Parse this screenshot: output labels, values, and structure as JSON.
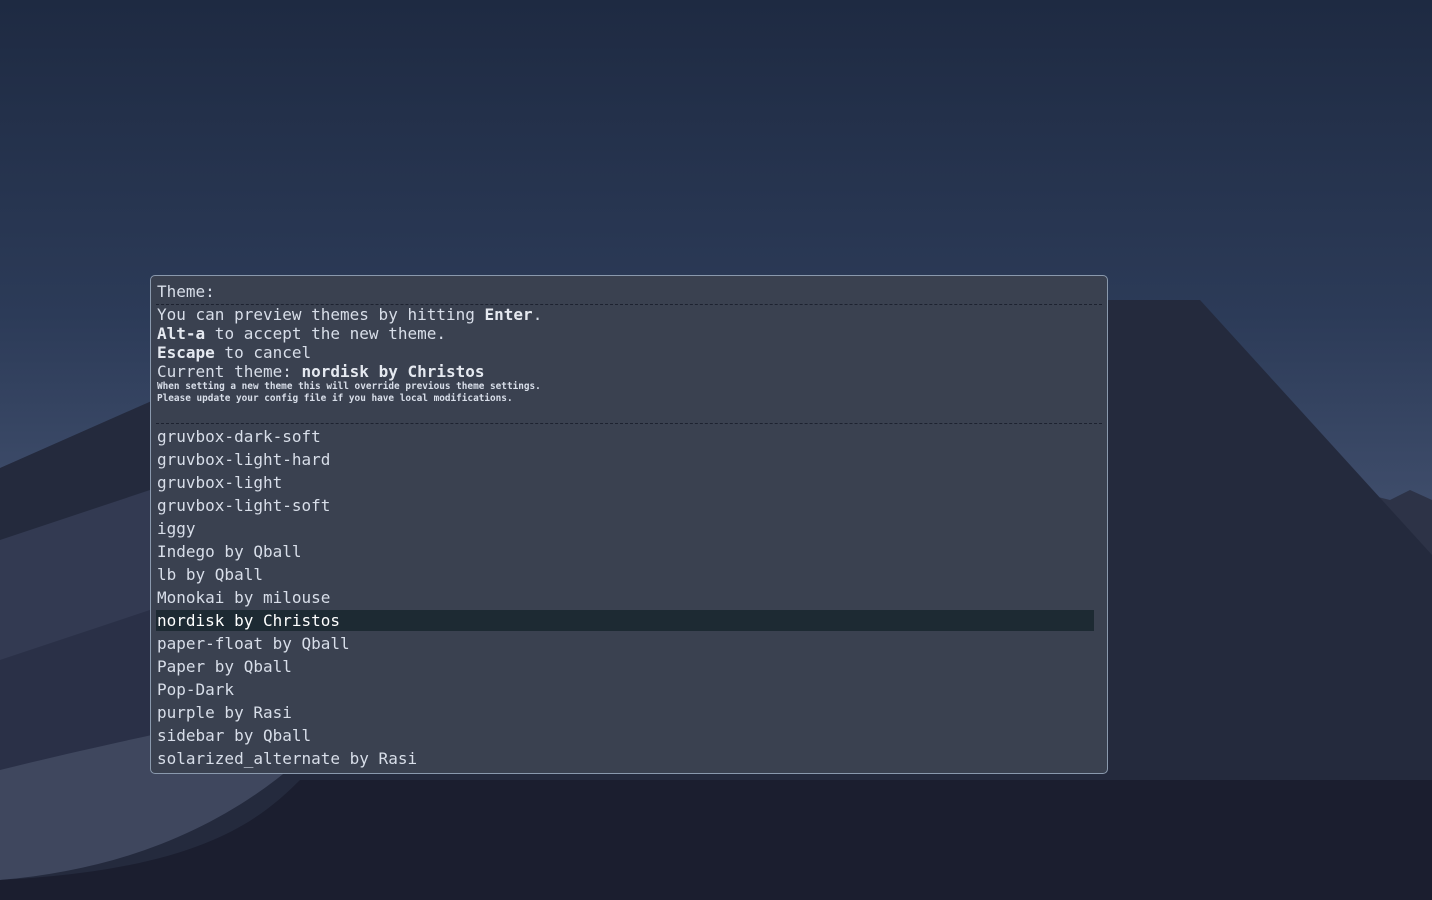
{
  "colors": {
    "window_bg": "#3a4150",
    "window_border": "#8a99ad",
    "text": "#d8dee9",
    "selected_bg": "#1d2a33",
    "selected_text": "#ffffff",
    "separator": "#1d2230"
  },
  "prompt": "Theme:",
  "message": {
    "line1": {
      "pre": "You can preview themes by hitting ",
      "bold": "Enter",
      "post": "."
    },
    "line2": {
      "bold": "Alt-a",
      "post": " to accept the new theme."
    },
    "line3": {
      "bold": "Escape",
      "post": " to cancel"
    },
    "line4": {
      "pre": "Current theme: ",
      "bold": "nordisk by Christos"
    },
    "note1": "When setting a new theme this will override previous theme settings.",
    "note2": "Please update your config file if you have local modifications."
  },
  "themes": [
    {
      "label": "gruvbox-dark-soft"
    },
    {
      "label": "gruvbox-light-hard"
    },
    {
      "label": "gruvbox-light"
    },
    {
      "label": "gruvbox-light-soft"
    },
    {
      "label": "iggy"
    },
    {
      "label": "Indego by Qball"
    },
    {
      "label": "lb by Qball"
    },
    {
      "label": "Monokai by milouse"
    },
    {
      "label": "nordisk by Christos",
      "selected": true
    },
    {
      "label": "paper-float by Qball"
    },
    {
      "label": "Paper by Qball"
    },
    {
      "label": "Pop-Dark"
    },
    {
      "label": "purple by Rasi"
    },
    {
      "label": "sidebar by Qball"
    },
    {
      "label": "solarized_alternate by Rasi"
    }
  ]
}
